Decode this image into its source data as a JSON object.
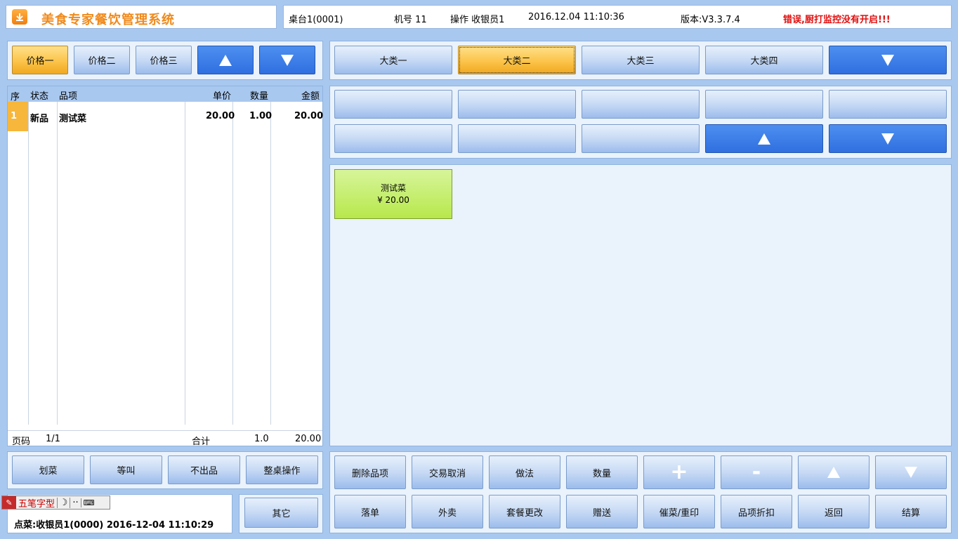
{
  "header": {
    "app_title": "美食专家餐饮管理系统",
    "table": "桌台1(0001)",
    "machine": "机号  11",
    "operator": "操作  收银员1",
    "datetime": "2016.12.04 11:10:36",
    "version": "版本:V3.3.7.4",
    "error": "错误,厨打监控没有开启!!!"
  },
  "price_tabs": [
    "价格一",
    "价格二",
    "价格三"
  ],
  "categories": [
    "大类一",
    "大类二",
    "大类三",
    "大类四"
  ],
  "order_table": {
    "headers": [
      "序",
      "状态",
      "品项",
      "单价",
      "数量",
      "金额"
    ],
    "rows": [
      {
        "no": "1",
        "status": "新品",
        "item": "测试菜",
        "price": "20.00",
        "qty": "1.00",
        "amount": "20.00"
      }
    ],
    "footer": {
      "page_label": "页码",
      "page": "1/1",
      "total_label": "合计",
      "total_qty": "1.0",
      "total_amount": "20.00"
    }
  },
  "dish": {
    "name": "测试菜",
    "price": "¥ 20.00"
  },
  "left_actions": [
    "划菜",
    "等叫",
    "不出品",
    "整桌操作"
  ],
  "other_label": "其它",
  "ime": {
    "label": "五笔字型"
  },
  "status_line": "点菜:收银员1(0000) 2016-12-04 11:10:29",
  "actions_row1": [
    "删除品项",
    "交易取消",
    "做法",
    "数量"
  ],
  "actions_row2": [
    "落单",
    "外卖",
    "套餐更改",
    "赠送",
    "催菜/重印",
    "品项折扣",
    "返回",
    "结算"
  ],
  "colors": {
    "background": "#a9c8ef",
    "orange": "#fbc44a",
    "blue": "#2f6fe0",
    "error": "#e01010",
    "title": "#f08a1c"
  }
}
